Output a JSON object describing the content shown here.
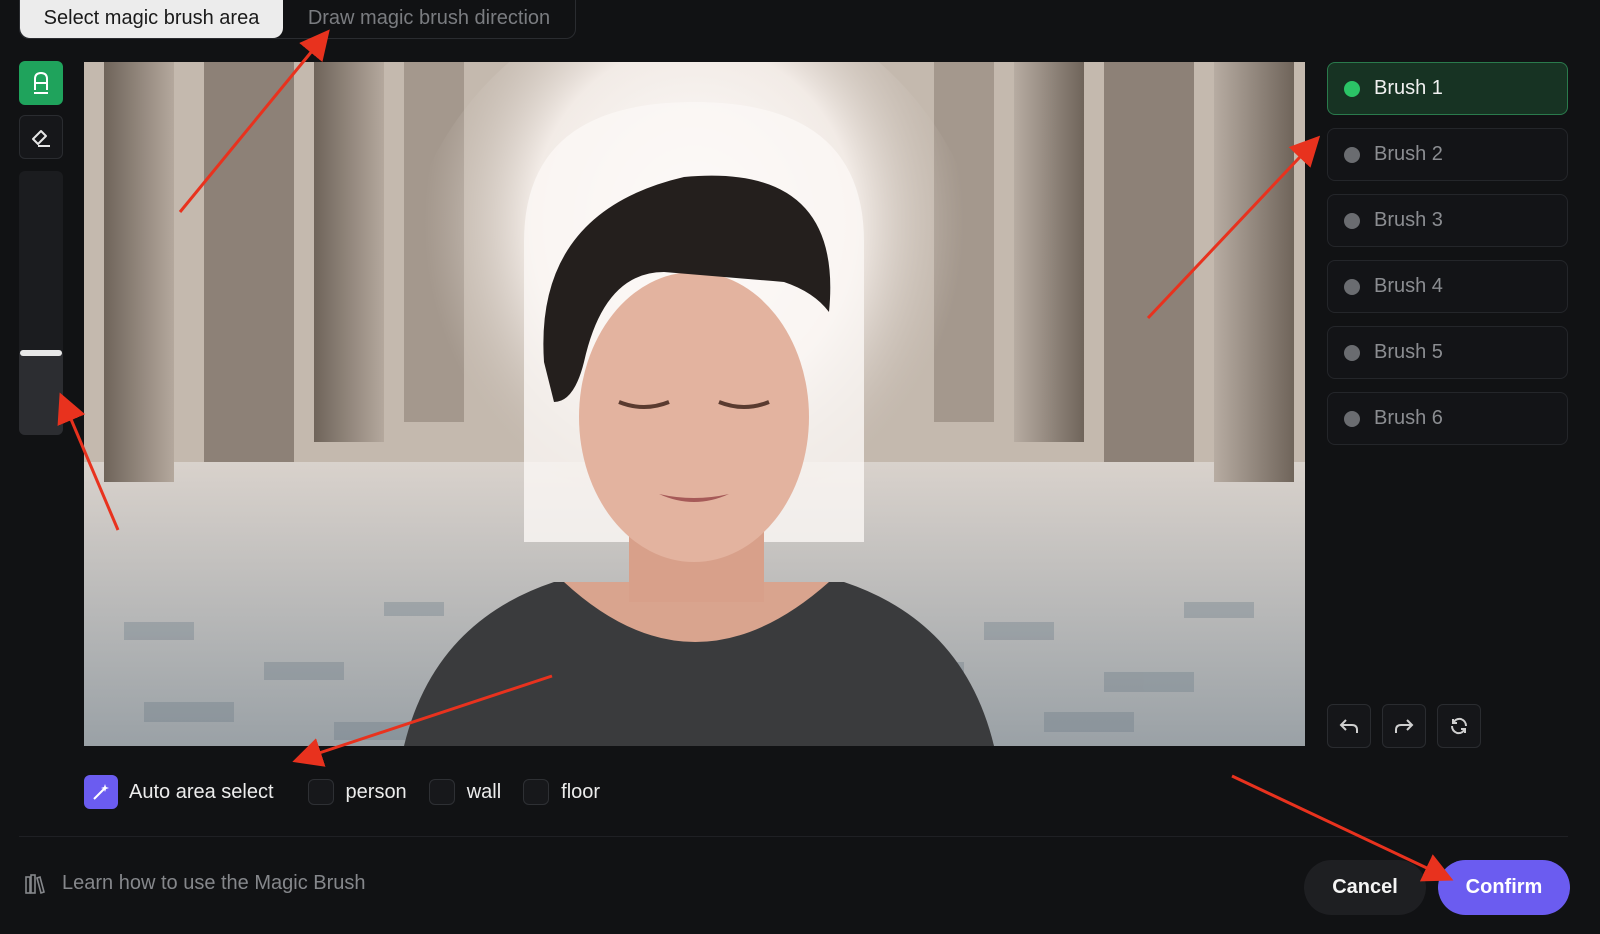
{
  "tabs": [
    {
      "label": "Select magic brush area",
      "active": true
    },
    {
      "label": "Draw magic brush direction",
      "active": false
    }
  ],
  "tools": {
    "brush_icon": "magic-brush-icon",
    "eraser_icon": "eraser-icon",
    "brush_size_level": 0.31
  },
  "brushes": [
    {
      "label": "Brush 1",
      "active": true
    },
    {
      "label": "Brush 2",
      "active": false
    },
    {
      "label": "Brush 3",
      "active": false
    },
    {
      "label": "Brush 4",
      "active": false
    },
    {
      "label": "Brush 5",
      "active": false
    },
    {
      "label": "Brush 6",
      "active": false
    }
  ],
  "history": {
    "undo_icon": "undo-icon",
    "redo_icon": "redo-icon",
    "reset_icon": "reset-icon"
  },
  "auto_select": {
    "label": "Auto area select",
    "options": [
      {
        "label": "person",
        "checked": false
      },
      {
        "label": "wall",
        "checked": false
      },
      {
        "label": "floor",
        "checked": false
      }
    ]
  },
  "footer": {
    "learn_link": "Learn how to use the Magic Brush",
    "cancel_label": "Cancel",
    "confirm_label": "Confirm"
  },
  "colors": {
    "accent_green": "#1fa35c",
    "accent_purple": "#6b5cf0",
    "annotation_arrow": "#e8321e"
  }
}
